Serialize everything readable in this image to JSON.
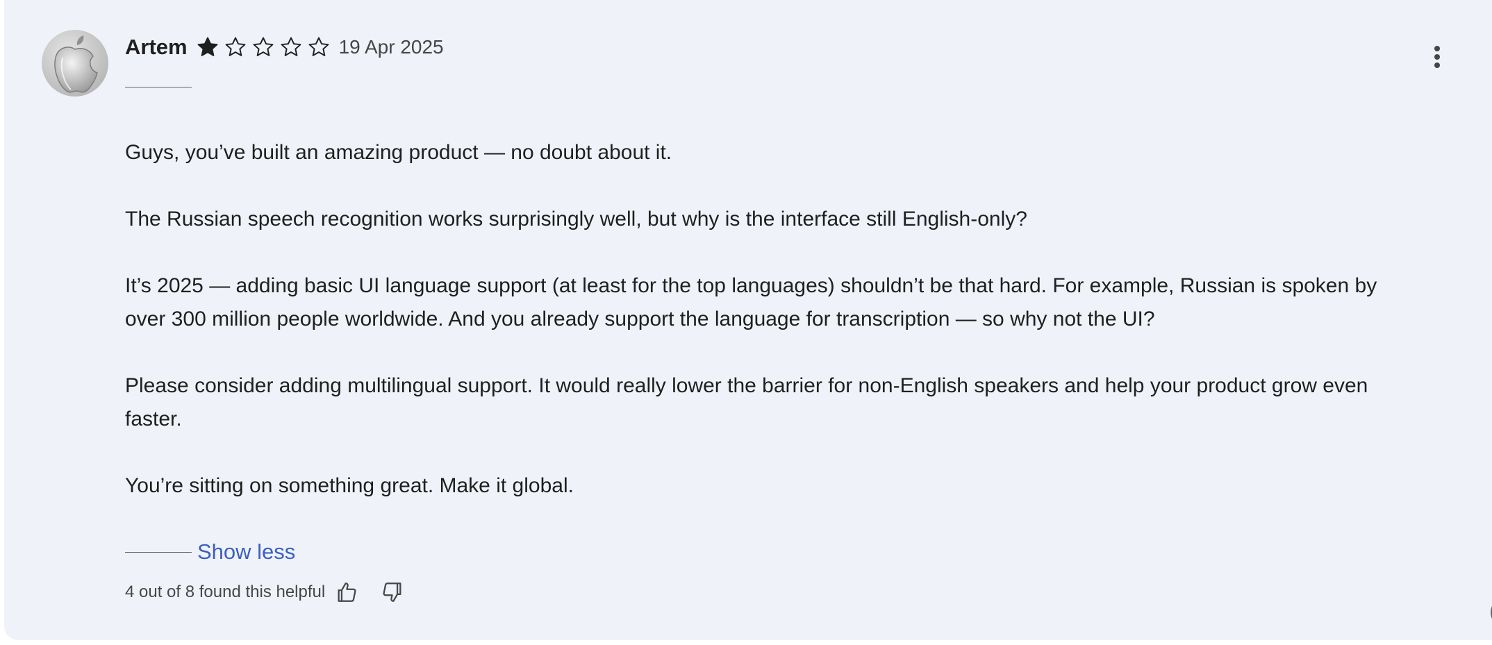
{
  "review": {
    "author": "Artem",
    "rating": 1,
    "rating_max": 5,
    "date": "19 Apr 2025",
    "paragraphs": [
      "Guys, you’ve built an amazing product — no doubt about it.",
      "The Russian speech recognition works surprisingly well, but why is the interface still English-only?",
      "It’s 2025 — adding basic UI language support (at least for the top languages) shouldn’t be that hard. For example, Russian is spoken by over 300 million people worldwide. And you already support the language for transcription — so why not the UI?",
      "Please consider adding multilingual support. It would really lower the barrier for non-English speakers and help your product grow even faster.",
      "You’re sitting on something great. Make it global."
    ],
    "show_less_label": "Show less",
    "helpful_text": "4 out of 8 found this helpful"
  },
  "icons": {
    "avatar": "apple-logo-avatar",
    "star_filled": "star-filled-icon",
    "star_empty": "star-outline-icon",
    "more": "more-vert-icon",
    "thumb_up": "thumb-up-icon",
    "thumb_down": "thumb-down-icon"
  },
  "colors": {
    "card_background": "#eff3f9",
    "link": "#3b5fc0",
    "text": "#1f1f1f",
    "secondary_text": "#444746"
  }
}
